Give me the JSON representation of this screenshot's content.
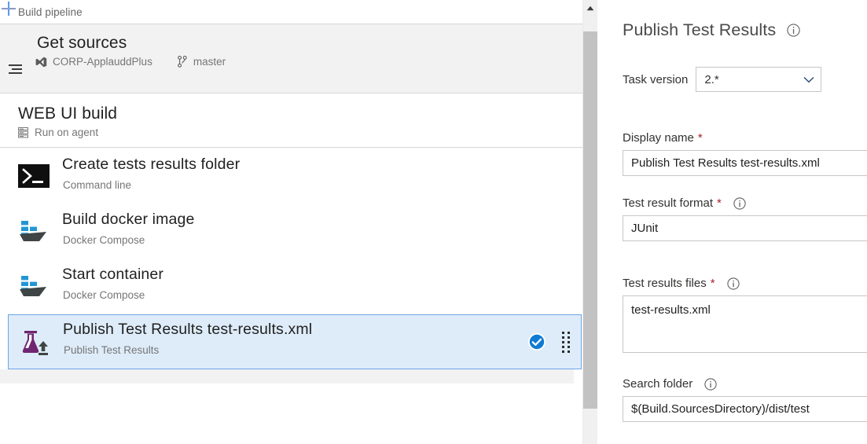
{
  "breadcrumb": {
    "label": "Build pipeline"
  },
  "pipeline": {
    "get_sources": {
      "icon": "align-list-icon",
      "title": "Get sources",
      "repo_icon": "visualstudio-repo-icon",
      "repo": "CORP-ApplauddPlus",
      "branch_icon": "branch-icon",
      "branch": "master"
    },
    "phase": {
      "title": "WEB UI build",
      "icon": "agent-server-icon",
      "subtitle": "Run on agent",
      "add_label": "+"
    },
    "tasks": [
      {
        "icon": "command-line-icon",
        "title": "Create tests results folder",
        "subtitle": "Command line",
        "selected": false
      },
      {
        "icon": "docker-compose-icon",
        "title": "Build docker image",
        "subtitle": "Docker Compose",
        "selected": false
      },
      {
        "icon": "docker-compose-icon",
        "title": "Start container",
        "subtitle": "Docker Compose",
        "selected": false
      },
      {
        "icon": "publish-test-results-flask-icon",
        "title": "Publish Test Results test-results.xml",
        "subtitle": "Publish Test Results",
        "selected": true,
        "status_icon": "check-circle-icon",
        "grip_icon": "drag-handle-icon"
      }
    ]
  },
  "scrollbar": {
    "up_icon": "caret-up-icon",
    "thumb": "vertical-scroll-thumb"
  },
  "details": {
    "title": "Publish Test Results",
    "title_info_icon": "info-icon",
    "task_version": {
      "label": "Task version",
      "value": "2.*",
      "chevron_icon": "chevron-down-icon"
    },
    "fields": [
      {
        "label": "Display name",
        "required": "*",
        "value": "Publish Test Results test-results.xml",
        "type": "text",
        "has_info": false
      },
      {
        "label": "Test result format",
        "required": "*",
        "value": "JUnit",
        "type": "text",
        "has_info": true,
        "info_icon": "info-icon"
      },
      {
        "label": "Test results files",
        "required": "*",
        "value": "test-results.xml",
        "type": "textarea",
        "has_info": true,
        "info_icon": "info-icon"
      },
      {
        "label": "Search folder",
        "required": "",
        "value": "$(Build.SourcesDirectory)/dist/test",
        "type": "text",
        "has_info": true,
        "info_icon": "info-icon"
      }
    ]
  },
  "colors": {
    "accent_blue": "#0078d4",
    "selected_row_bg": "#deecf9",
    "selected_row_border": "#6ba5e7",
    "section_gray": "#f2f2f2",
    "flask_purple": "#702670",
    "docker_blue": "#2296d3",
    "required_red": "#a4262c",
    "text_primary": "#212121",
    "text_secondary": "#767676"
  }
}
